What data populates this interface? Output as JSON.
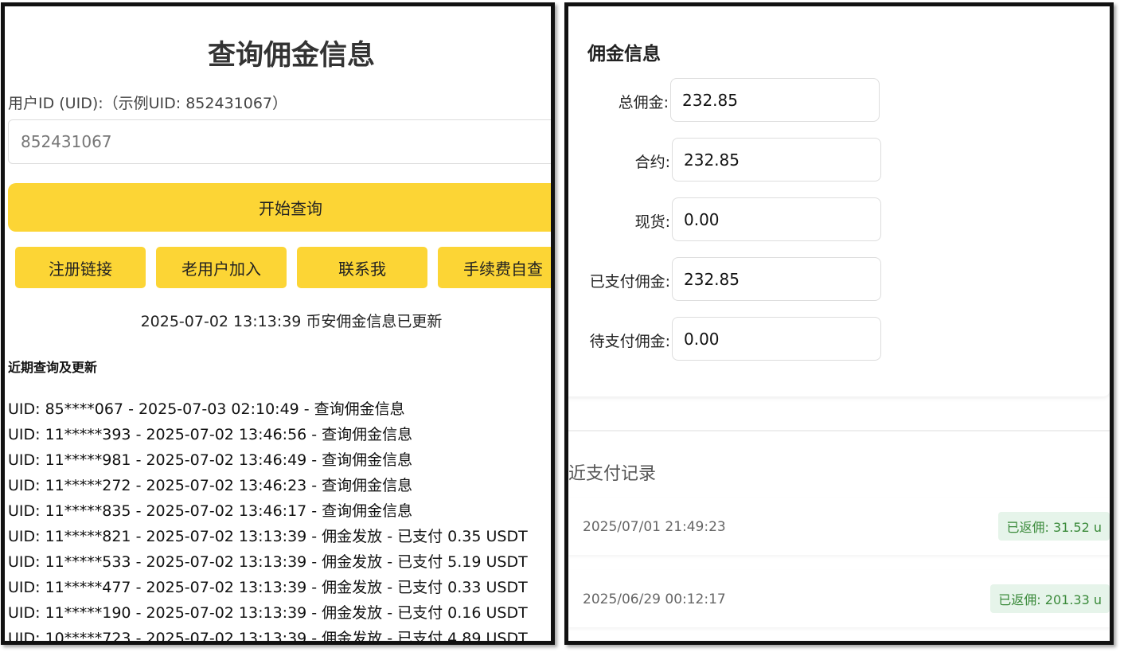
{
  "left": {
    "title": "查询佣金信息",
    "uid_label": "用户ID (UID):（示例UID: 852431067）",
    "uid_placeholder": "852431067",
    "query_button": "开始查询",
    "buttons": [
      "注册链接",
      "老用户加入",
      "联系我",
      "手续费自查"
    ],
    "update_notice": "2025-07-02 13:13:39 币安佣金信息已更新",
    "recent_title": "近期查询及更新",
    "log": [
      "UID: 85****067 - 2025-07-03 02:10:49 - 查询佣金信息",
      "UID: 11*****393 - 2025-07-02 13:46:56 - 查询佣金信息",
      "UID: 11*****981 - 2025-07-02 13:46:49 - 查询佣金信息",
      "UID: 11*****272 - 2025-07-02 13:46:23 - 查询佣金信息",
      "UID: 11*****835 - 2025-07-02 13:46:17 - 查询佣金信息",
      "UID: 11*****821 - 2025-07-02 13:13:39 - 佣金发放 - 已支付 0.35 USDT",
      "UID: 11*****533 - 2025-07-02 13:13:39 - 佣金发放 - 已支付 5.19 USDT",
      "UID: 11*****477 - 2025-07-02 13:13:39 - 佣金发放 - 已支付 0.33 USDT",
      "UID: 11*****190 - 2025-07-02 13:13:39 - 佣金发放 - 已支付 0.16 USDT",
      "UID: 10*****723 - 2025-07-02 13:13:39 - 佣金发放 - 已支付 4.89 USDT"
    ]
  },
  "right": {
    "title": "佣金信息",
    "fields": [
      {
        "label": "总佣金:",
        "value": "232.85"
      },
      {
        "label": "合约:",
        "value": "232.85"
      },
      {
        "label": "现货:",
        "value": "0.00"
      },
      {
        "label": "已支付佣金:",
        "value": "232.85"
      },
      {
        "label": "待支付佣金:",
        "value": "0.00"
      }
    ],
    "payments_title": "最近支付记录",
    "payments": [
      {
        "date": "2025/07/01 21:49:23",
        "badge": "已返佣: 31.52 u"
      },
      {
        "date": "2025/06/29 00:12:17",
        "badge": "已返佣: 201.33 u"
      }
    ]
  },
  "colors": {
    "accent": "#fcd535",
    "badge_bg": "#e6f4ea",
    "badge_text": "#3a8a3a"
  }
}
